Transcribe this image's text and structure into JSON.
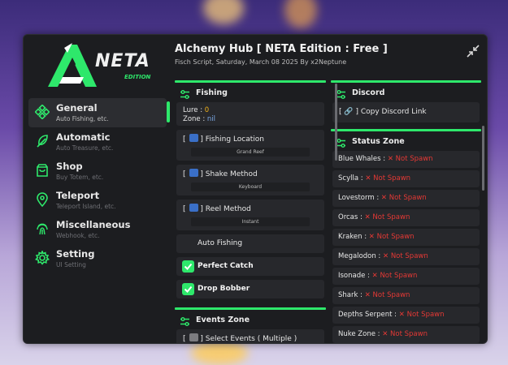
{
  "header": {
    "title": "Alchemy Hub [ NETA Edition : Free ]",
    "subtitle": "Fisch Script, Saturday, March 08 2025 By x2Neptune",
    "logo_text": "NETA",
    "logo_sub": "EDITION"
  },
  "sidebar": {
    "items": [
      {
        "label": "General",
        "sub": "Auto Fishing, etc.",
        "icon": "grid-diamond-icon"
      },
      {
        "label": "Automatic",
        "sub": "Auto Treasure, etc.",
        "icon": "feather-icon"
      },
      {
        "label": "Shop",
        "sub": "Buy Totem, etc.",
        "icon": "bag-icon"
      },
      {
        "label": "Teleport",
        "sub": "Teleport Island, etc.",
        "icon": "location-pin-icon"
      },
      {
        "label": "Miscellaneous",
        "sub": "Webhook, etc.",
        "icon": "fingerprint-icon"
      },
      {
        "label": "Setting",
        "sub": "UI Setting",
        "icon": "gear-icon"
      }
    ]
  },
  "fishing": {
    "title": "Fishing",
    "lure_label": "Lure : ",
    "lure_value": "0",
    "zone_label": "Zone : ",
    "zone_value": "nil",
    "location_title": "Fishing Location",
    "location_value": "Grand Reef",
    "shake_title": "Shake Method",
    "shake_value": "Keyboard",
    "reel_title": "Reel Method",
    "reel_value": "Instant",
    "auto_fishing": "Auto Fishing",
    "perfect_catch": "Perfect Catch",
    "drop_bobber": "Drop Bobber"
  },
  "events": {
    "title": "Events Zone",
    "select_label": "Select Events ( Multiple )"
  },
  "discord": {
    "title": "Discord",
    "copy_label": "Copy Discord Link"
  },
  "status": {
    "title": "Status Zone",
    "not_spawn": "Not Spawn",
    "rows": [
      {
        "name": "Blue Whales : "
      },
      {
        "name": "Scylla : "
      },
      {
        "name": "Lovestorm : "
      },
      {
        "name": "Orcas : "
      },
      {
        "name": "Kraken : "
      },
      {
        "name": "Megalodon : "
      },
      {
        "name": "Isonade : "
      },
      {
        "name": "Shark : "
      },
      {
        "name": "Depths Serpent : "
      },
      {
        "name": "Nuke Zone : "
      }
    ]
  },
  "colors": {
    "accent": "#2ee86b",
    "danger": "#e53935",
    "number": "#f2b21a"
  }
}
